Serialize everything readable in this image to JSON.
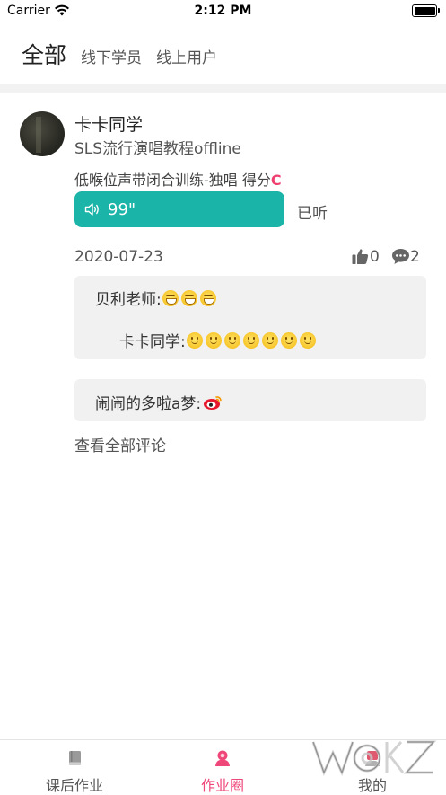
{
  "status_bar": {
    "carrier": "Carrier",
    "time": "2:12 PM"
  },
  "top_tabs": {
    "active": "全部",
    "offline": "线下学员",
    "online": "线上用户"
  },
  "post": {
    "user_name": "卡卡同学",
    "course": "SLS流行演唱教程offline",
    "lesson": "低喉位声带闭合训练-独唱 得分",
    "score_grade": "C",
    "audio_duration": "99\"",
    "listened_label": "已听",
    "date": "2020-07-23",
    "like_count": "0",
    "comment_count": "2",
    "accent_color": "#1ab4a8",
    "grade_color": "#ee3f6f"
  },
  "comments": [
    {
      "author": "贝利老师:",
      "emoji": [
        "grin",
        "grin",
        "grin"
      ]
    },
    {
      "author": "卡卡同学:",
      "emoji": [
        "smile",
        "smile",
        "smile",
        "smile",
        "smile",
        "smile",
        "smile"
      ]
    },
    {
      "author": "闹闹的多啦a梦:",
      "emoji": [
        "weibo-icon"
      ]
    }
  ],
  "view_all_comments": "查看全部评论",
  "bottom_tabs": [
    {
      "label": "课后作业",
      "icon": "book-icon"
    },
    {
      "label": "作业圈",
      "icon": "homework-circle-icon",
      "active": true,
      "color": "#f0477a"
    },
    {
      "label": "我的",
      "icon": "profile-icon"
    }
  ]
}
